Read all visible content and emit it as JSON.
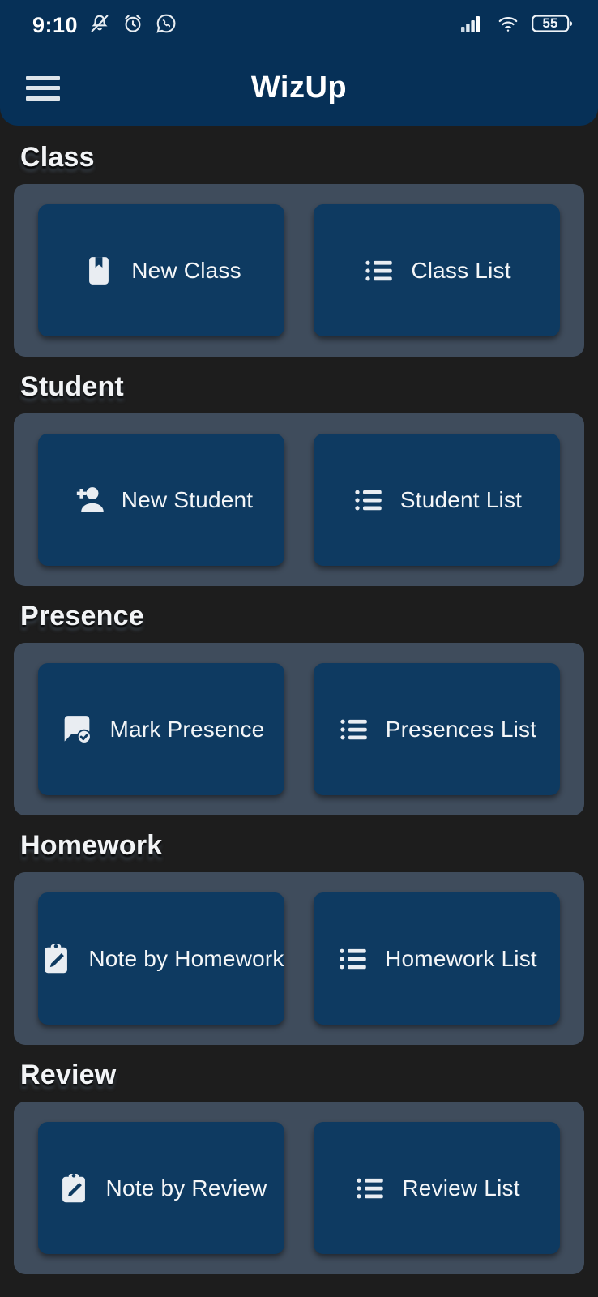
{
  "statusbar": {
    "time": "9:10",
    "left_icons": [
      "bell-off-icon",
      "alarm-clock-icon",
      "whatsapp-icon"
    ],
    "right_icons": [
      "cellular-signal-icon",
      "wifi-icon"
    ],
    "battery_level": "55"
  },
  "appbar": {
    "menu_icon": "hamburger-menu-icon",
    "title": "WizUp"
  },
  "colors": {
    "page_background": "#1d1d1d",
    "appbar": "#063057",
    "card": "#3f4c5c",
    "tile": "#0e3a61",
    "text": "#f4f6f8"
  },
  "sections": [
    {
      "title": "Class",
      "primary": {
        "label": "New Class",
        "icon": "book-bookmark-icon"
      },
      "secondary": {
        "label": "Class List",
        "icon": "list-icon"
      }
    },
    {
      "title": "Student",
      "primary": {
        "label": "New Student",
        "icon": "person-add-icon"
      },
      "secondary": {
        "label": "Student List",
        "icon": "list-icon"
      }
    },
    {
      "title": "Presence",
      "primary": {
        "label": "Mark Presence",
        "icon": "chat-check-icon"
      },
      "secondary": {
        "label": "Presences List",
        "icon": "list-icon"
      }
    },
    {
      "title": "Homework",
      "primary": {
        "label": "Note by Homework",
        "icon": "clipboard-pencil-icon"
      },
      "secondary": {
        "label": "Homework List",
        "icon": "list-icon"
      }
    },
    {
      "title": "Review",
      "primary": {
        "label": "Note by Review",
        "icon": "clipboard-pencil-icon"
      },
      "secondary": {
        "label": "Review List",
        "icon": "list-icon"
      }
    }
  ]
}
